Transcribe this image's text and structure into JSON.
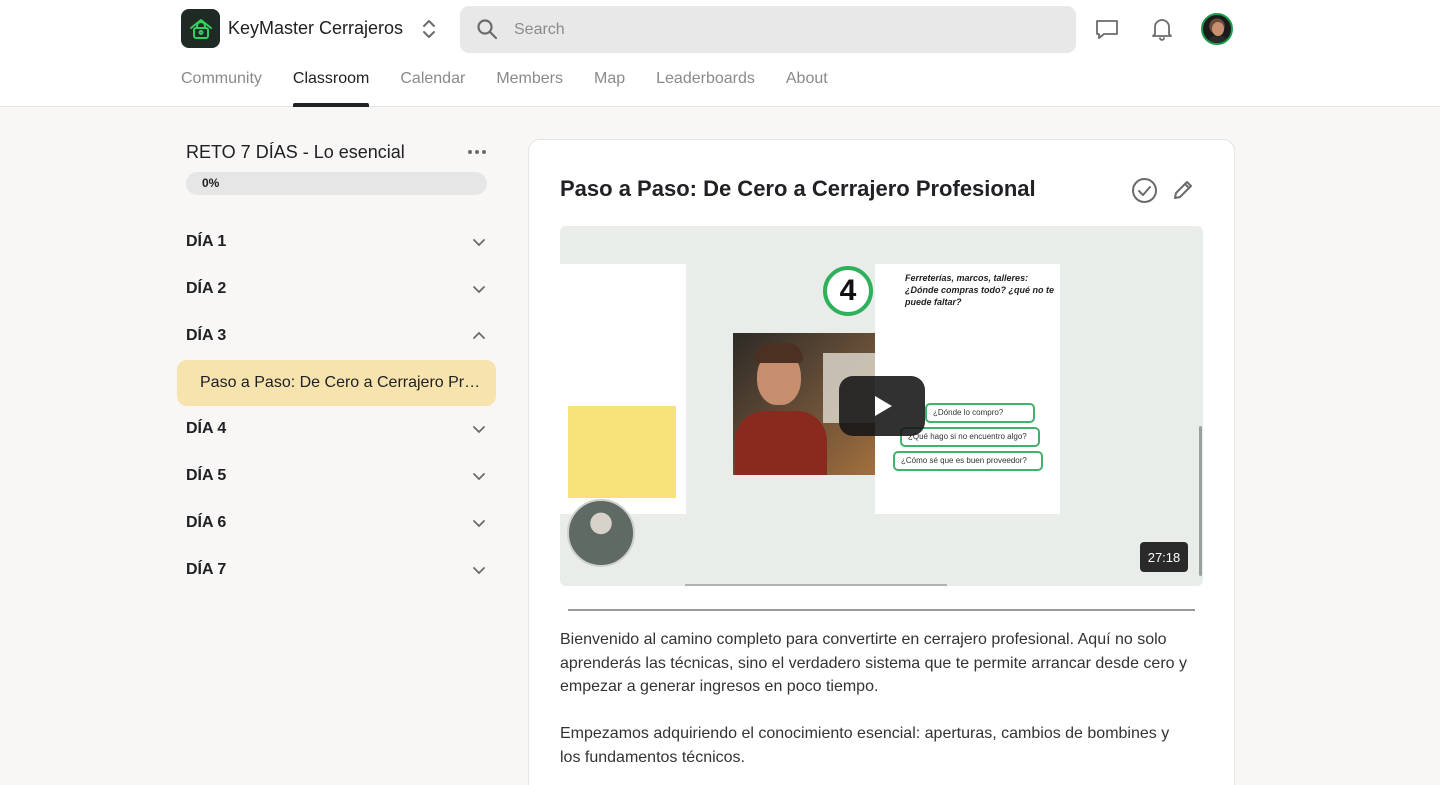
{
  "header": {
    "brand": "KeyMaster Cerrajeros",
    "search_placeholder": "Search",
    "icons": [
      "lock-house-logo-icon",
      "switcher-chevrons-icon",
      "search-icon",
      "chat-icon",
      "bell-icon",
      "avatar"
    ]
  },
  "tabs": [
    {
      "label": "Community",
      "active": false
    },
    {
      "label": "Classroom",
      "active": true
    },
    {
      "label": "Calendar",
      "active": false
    },
    {
      "label": "Members",
      "active": false
    },
    {
      "label": "Map",
      "active": false
    },
    {
      "label": "Leaderboards",
      "active": false
    },
    {
      "label": "About",
      "active": false
    }
  ],
  "sidebar": {
    "course_title": "RETO 7 DÍAS - Lo esencial",
    "progress_label": "0%",
    "progress_value": 0,
    "days": [
      "DÍA 1",
      "DÍA 2",
      "DÍA 3",
      "DÍA 4",
      "DÍA 5",
      "DÍA 6",
      "DÍA 7"
    ],
    "expanded_day": "DÍA 3",
    "active_lesson": "Paso a Paso: De Cero a Cerrajero Profesional"
  },
  "main": {
    "lesson_title": "Paso a Paso: De Cero a Cerrajero Profesional",
    "video": {
      "duration": "27:18",
      "slide_number": "4",
      "slide_heading": "Ferreterías, marcos, talleres: ¿Dónde compras todo? ¿qué no te puede faltar?",
      "slide_buttons": [
        "¿Dónde lo compro?",
        "¿Qué hago si no encuentro algo?",
        "¿Cómo sé que es buen proveedor?"
      ]
    },
    "paragraphs": [
      "Bienvenido al camino completo para convertirte en cerrajero profesional. Aquí no solo aprenderás las técnicas, sino el verdadero sistema que te permite arrancar desde cero y empezar a generar ingresos en poco tiempo.",
      "Empezamos adquiriendo el conocimiento esencial: aperturas, cambios de bombines y los fundamentos técnicos."
    ]
  },
  "colors": {
    "accent_green": "#2fb05a",
    "active_lesson_bg": "#f6e3ae",
    "page_bg": "#f8f7f5"
  }
}
